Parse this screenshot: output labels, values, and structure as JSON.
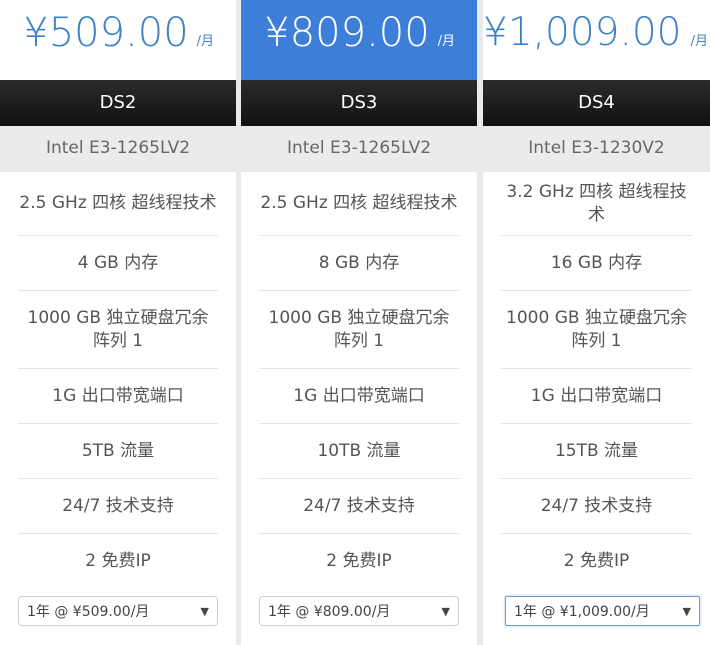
{
  "plans": [
    {
      "price": "¥509.00",
      "per": "/月",
      "name": "DS2",
      "cpu": "Intel E3-1265LV2",
      "features": [
        "2.5 GHz 四核 超线程技术",
        "4 GB 内存",
        "1000 GB 独立硬盘冗余阵列 1",
        "1G 出口带宽端口",
        "5TB 流量",
        "24/7 技术支持",
        "2 免费IP"
      ],
      "select_value": "1年 @ ¥509.00/月"
    },
    {
      "price": "¥809.00",
      "per": "/月",
      "name": "DS3",
      "cpu": "Intel E3-1265LV2",
      "features": [
        "2.5 GHz 四核 超线程技术",
        "8 GB 内存",
        "1000 GB 独立硬盘冗余阵列 1",
        "1G 出口带宽端口",
        "10TB 流量",
        "24/7 技术支持",
        "2 免费IP"
      ],
      "select_value": "1年 @ ¥809.00/月"
    },
    {
      "price": "¥1,009.00",
      "per": "/月",
      "name": "DS4",
      "cpu": "Intel E3-1230V2",
      "features": [
        "3.2 GHz 四核 超线程技术",
        "16 GB 内存",
        "1000 GB 独立硬盘冗余阵列 1",
        "1G 出口带宽端口",
        "15TB 流量",
        "24/7 技术支持",
        "2 免费IP"
      ],
      "select_value": "1年 @ ¥1,009.00/月"
    }
  ],
  "colors": {
    "price_text": "#3b82c8",
    "featured_bg": "#3d7fd8",
    "plan_header_bg": "#1a1a1a",
    "cpu_bg": "#ebebeb"
  },
  "icons": {
    "select_caret": "caret-down-icon"
  }
}
